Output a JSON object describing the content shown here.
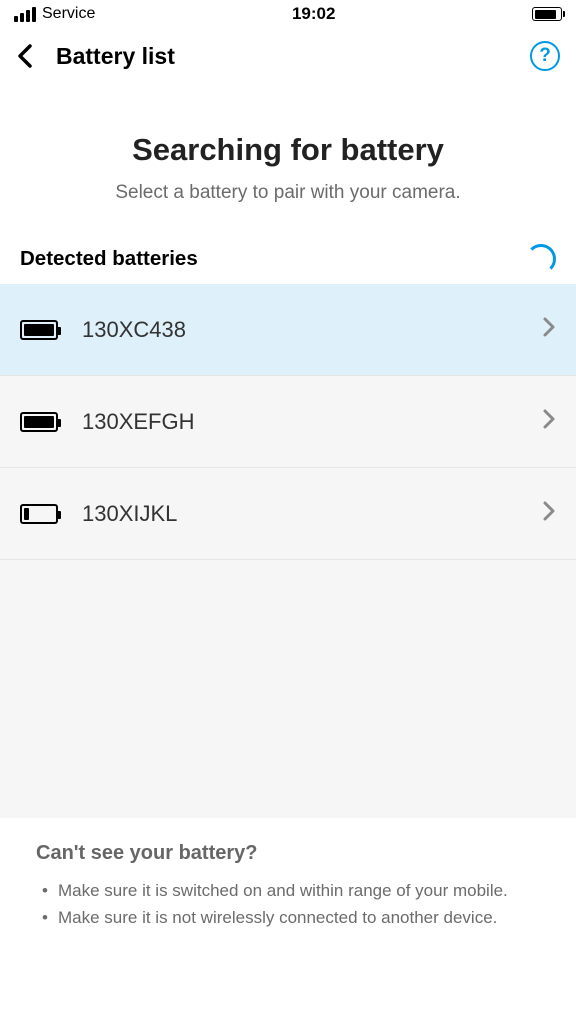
{
  "status": {
    "carrier": "Service",
    "time": "19:02"
  },
  "header": {
    "title": "Battery list"
  },
  "hero": {
    "title": "Searching for battery",
    "subtitle": "Select a battery to pair with your camera."
  },
  "section": {
    "title": "Detected batteries"
  },
  "batteries": [
    {
      "id": "130XC438",
      "selected": true,
      "level": "full"
    },
    {
      "id": "130XEFGH",
      "selected": false,
      "level": "full"
    },
    {
      "id": "130XIJKL",
      "selected": false,
      "level": "low"
    }
  ],
  "footer": {
    "title": "Can't see your battery?",
    "tips": [
      "Make sure it is switched on and within range of your mobile.",
      "Make sure it is not wirelessly connected to another device."
    ]
  }
}
